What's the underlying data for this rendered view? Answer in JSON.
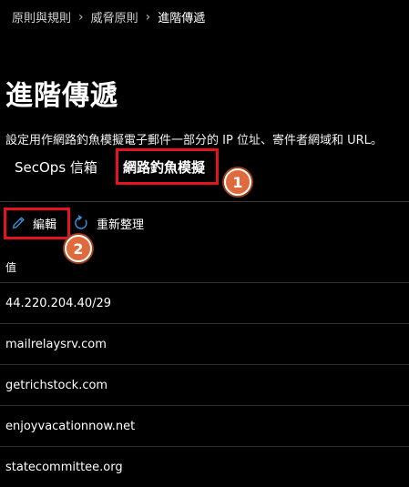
{
  "breadcrumb": {
    "items": [
      "原則與規則",
      "威脅原則"
    ],
    "current": "進階傳遞"
  },
  "page": {
    "title": "進階傳遞",
    "description": "設定用作網路釣魚模擬電子郵件一部分的 IP 位址、寄件者網域和 URL。"
  },
  "tabs": [
    {
      "label": "SecOps 信箱",
      "selected": false
    },
    {
      "label": "網路釣魚模擬",
      "selected": true
    }
  ],
  "toolbar": {
    "edit_label": "編輯",
    "refresh_label": "重新整理"
  },
  "table": {
    "column_header": "值",
    "rows": [
      "44.220.204.40/29",
      "mailrelaysrv.com",
      "getrichstock.com",
      "enjoyvacationnow.net",
      "statecommittee.org"
    ]
  },
  "annotations": {
    "badge_1": "1",
    "badge_2": "2",
    "highlight_color": "#e3141e",
    "badge_color": "#e06a3c"
  },
  "icons": {
    "edit": "pencil-icon",
    "refresh": "refresh-icon",
    "separator": "chevron-right-icon"
  }
}
